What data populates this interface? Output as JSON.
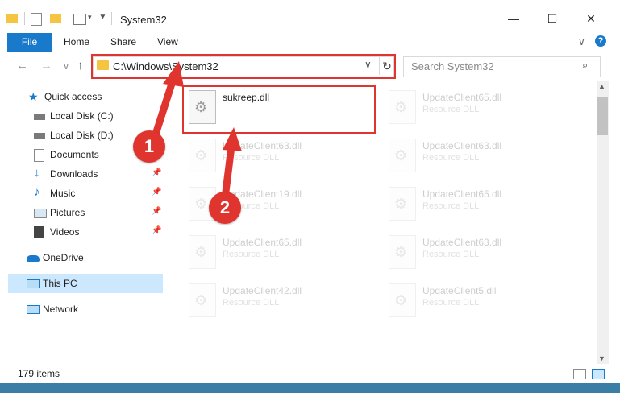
{
  "window": {
    "title": "System32",
    "minimize_glyph": "—",
    "maximize_glyph": "☐",
    "close_glyph": "✕"
  },
  "ribbon": {
    "tabs": [
      "File",
      "Home",
      "Share",
      "View"
    ],
    "expand_glyph": "∨",
    "help_glyph": "?"
  },
  "nav": {
    "back_glyph": "←",
    "forward_glyph": "→",
    "recent_glyph": "∨",
    "up_glyph": "↑",
    "address": "C:\\Windows\\System32",
    "address_chevron": "∨",
    "refresh_glyph": "↻",
    "search_placeholder": "Search System32",
    "search_glyph": "⌕"
  },
  "sidebar": {
    "items": [
      {
        "label": "Quick access",
        "icon": "star-icon"
      },
      {
        "label": "Local Disk (C:)",
        "icon": "drive-icon"
      },
      {
        "label": "Local Disk (D:)",
        "icon": "drive-icon"
      },
      {
        "label": "Documents",
        "icon": "documents-icon"
      },
      {
        "label": "Downloads",
        "icon": "download-icon"
      },
      {
        "label": "Music",
        "icon": "music-icon"
      },
      {
        "label": "Pictures",
        "icon": "pictures-icon"
      },
      {
        "label": "Videos",
        "icon": "videos-icon"
      },
      {
        "label": "OneDrive",
        "icon": "cloud-icon"
      },
      {
        "label": "This PC",
        "icon": "computer-icon"
      },
      {
        "label": "Network",
        "icon": "network-icon"
      }
    ],
    "pin_glyph": "📌"
  },
  "files": [
    {
      "name": "sukreep.dll",
      "type": ""
    },
    {
      "name": "UpdateClient65.dll",
      "type": "Resource DLL"
    },
    {
      "name": "UpdateClient63.dll",
      "type": "Resource DLL"
    },
    {
      "name": "UpdateClient63.dll",
      "type": "Resource DLL"
    },
    {
      "name": "UpdateClient19.dll",
      "type": "Resource DLL"
    },
    {
      "name": "UpdateClient65.dll",
      "type": "Resource DLL"
    },
    {
      "name": "UpdateClient65.dll",
      "type": "Resource DLL"
    },
    {
      "name": "UpdateClient63.dll",
      "type": "Resource DLL"
    },
    {
      "name": "UpdateClient42.dll",
      "type": "Resource DLL"
    },
    {
      "name": "UpdateClient5.dll",
      "type": "Resource DLL"
    }
  ],
  "annotations": {
    "step1": "1",
    "step2": "2",
    "color": "#e0342f"
  },
  "status": {
    "count": "179 items"
  },
  "colors": {
    "accent": "#1979ca",
    "selection": "#cce8ff",
    "folder": "#f5c542"
  }
}
